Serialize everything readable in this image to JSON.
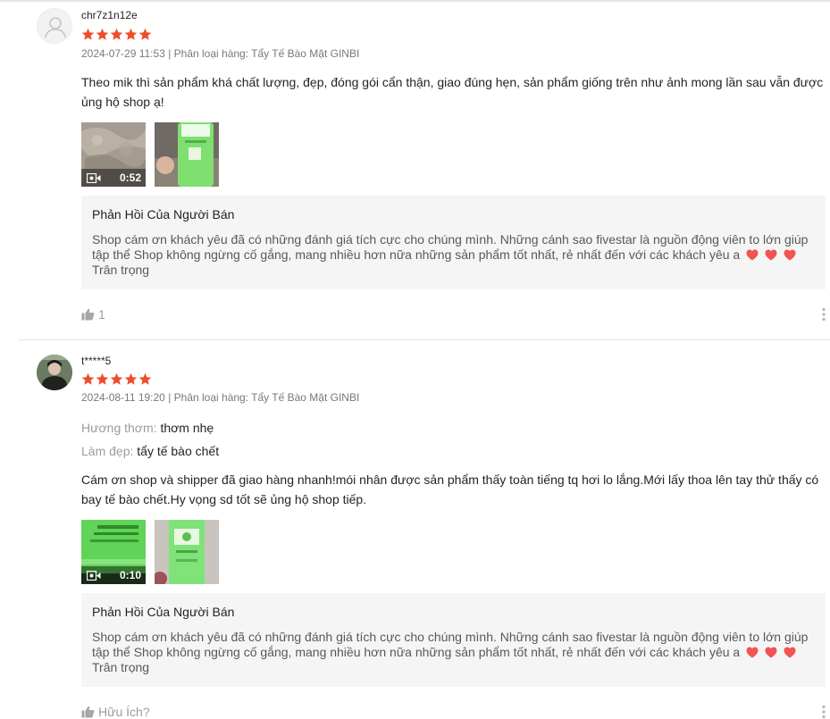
{
  "colors": {
    "star": "#ee4d2d",
    "heart": "#f05454",
    "reply_bg": "#f5f5f5"
  },
  "reviews": [
    {
      "username": "chr7z1n12e",
      "rating": 5,
      "meta": "2024-07-29 11:53 | Phân loại hàng: Tẩy Tế Bào Mặt GINBI",
      "content": "Theo mik thì sản phẩm khá chất lượng, đẹp, đóng gói cẩn thận, giao đúng hẹn, sản phẩm giống trên như ảnh mong lần sau vẫn được ủng hộ shop ạ!",
      "video_duration": "0:52",
      "reply_title": "Phản Hồi Của Người Bán",
      "reply_body": "Shop cám ơn khách yêu đã có những đánh giá tích cực cho chúng mình. Những cánh sao fivestar là nguồn động viên to lớn giúp tập thể Shop không ngừng cố gắng, mang nhiều hơn nữa những sản phẩm tốt nhất, rẻ nhất đến với các khách yêu a",
      "reply_sign": "Trân trọng",
      "like_count": "1",
      "avatar_icon": "default-avatar-icon"
    },
    {
      "username": "t*****5",
      "rating": 5,
      "meta": "2024-08-11 19:20 | Phân loại hàng: Tẩy Tế Bào Mặt GINBI",
      "attributes": [
        {
          "key": "Hương thơm:",
          "value": "thơm nhẹ"
        },
        {
          "key": "Làm đẹp:",
          "value": "tẩy tế bào chết"
        }
      ],
      "content": "Cám ơn shop và shipper đã giao hàng nhanh!mói nhân được sản phẩm thấy toàn tiếng tq hơi lo lắng.Mới lấy thoa lên tay thử thấy có bay tế bào chết.Hy vọng sd tốt sẽ ủng hộ shop tiếp.",
      "video_duration": "0:10",
      "reply_title": "Phản Hồi Của Người Bán",
      "reply_body": "Shop cám ơn khách yêu đã có những đánh giá tích cực cho chúng mình. Những cánh sao fivestar là nguồn động viên to lớn giúp tập thể Shop không ngừng cố gắng, mang nhiều hơn nữa những sản phẩm tốt nhất, rẻ nhất đến với các khách yêu a",
      "reply_sign": "Trân trọng",
      "helpful_label": "Hữu Ích?",
      "avatar_icon": "user-photo-avatar"
    }
  ]
}
